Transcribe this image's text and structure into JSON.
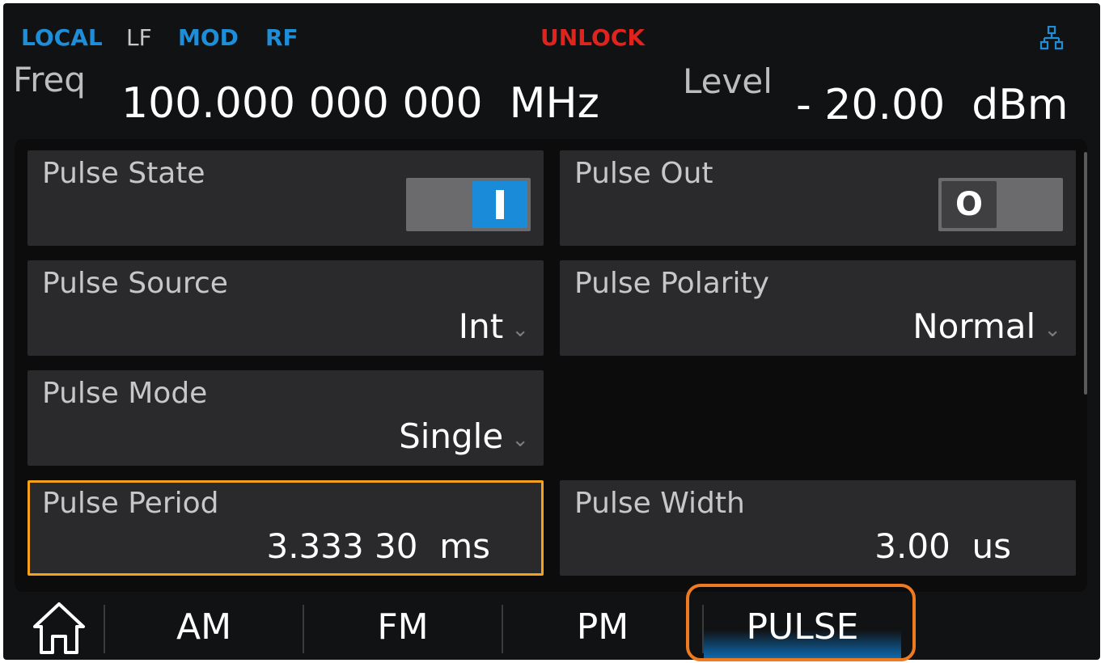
{
  "status": {
    "local": "LOCAL",
    "lf": "LF",
    "mod": "MOD",
    "rf": "RF",
    "lock": "UNLOCK",
    "network_icon": "network-icon"
  },
  "header": {
    "freq_label": "Freq",
    "freq_value": "100.000 000 000  MHz",
    "level_label": "Level",
    "level_value": "- 20.00  dBm"
  },
  "params": {
    "pulse_state": {
      "label": "Pulse State",
      "state": "on"
    },
    "pulse_out": {
      "label": "Pulse Out",
      "state": "off",
      "knob_text": "O"
    },
    "pulse_source": {
      "label": "Pulse Source",
      "value": "Int"
    },
    "pulse_polarity": {
      "label": "Pulse Polarity",
      "value": "Normal"
    },
    "pulse_mode": {
      "label": "Pulse Mode",
      "value": "Single"
    },
    "pulse_period": {
      "label": "Pulse Period",
      "value": "3.333 30  ms"
    },
    "pulse_width": {
      "label": "Pulse Width",
      "value": "3.00  us"
    }
  },
  "tabs": {
    "home_icon": "home-icon",
    "am": "AM",
    "fm": "FM",
    "pm": "PM",
    "pulse": "PULSE",
    "active": "PULSE"
  },
  "colors": {
    "accent_blue": "#1a8bd8",
    "unlock_red": "#e0231d",
    "selection_orange": "#f3a21a",
    "tab_highlight_orange": "#f07a20"
  }
}
